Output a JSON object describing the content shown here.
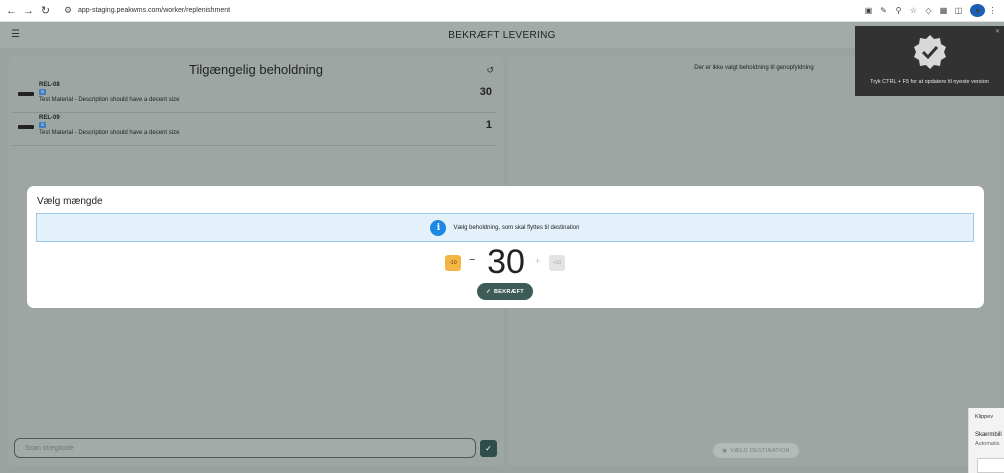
{
  "browser": {
    "url": "app-staging.peakwms.com/worker/replenishment",
    "back_icon": "arrow-left-icon",
    "forward_icon": "arrow-right-icon",
    "reload_icon": "reload-icon"
  },
  "header": {
    "title": "BEKRÆFT LEVERING"
  },
  "inventory": {
    "title": "Tilgængelig beholdning",
    "items": [
      {
        "code": "REL-08",
        "tag": "S",
        "description": "Test Material - Description should have a decent size",
        "qty": "30"
      },
      {
        "code": "REL-09",
        "tag": "S",
        "description": "Test Material - Description should have a decent size",
        "qty": "1"
      }
    ]
  },
  "replenishment": {
    "empty_message": "Der er ikke valgt beholdning til genopfyldning",
    "destination_button": "VÆLG DESTINATION"
  },
  "scan": {
    "placeholder": "Scan stregkode"
  },
  "toast": {
    "message": "Tryk CTRL + F5 for at opdatere til nyeste version"
  },
  "modal": {
    "title": "Vælg mængde",
    "info": "Vælg beholdning, som skal flyttes til destination",
    "minus_ten": "-10",
    "plus_ten": "+10",
    "minus_sign": "−",
    "plus_sign": "+",
    "quantity": "30",
    "confirm": "BEKRÆFT"
  },
  "notification": {
    "app": "Klippev",
    "title": "Skærmbill",
    "subtitle": "Automatis"
  },
  "colors": {
    "accent": "#3e5c57",
    "info_blue": "#1e88e5",
    "warning_orange": "#f5b545",
    "toast_bg": "#323232"
  }
}
